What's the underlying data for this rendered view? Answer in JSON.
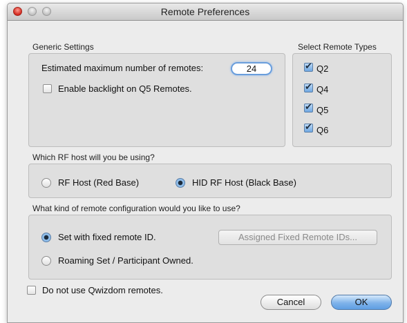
{
  "window": {
    "title": "Remote Preferences"
  },
  "generic": {
    "label": "Generic Settings",
    "max_remotes_label": "Estimated maximum number of remotes:",
    "max_remotes_value": "24",
    "backlight_label": "Enable backlight on Q5 Remotes.",
    "backlight_checked": false
  },
  "remote_types": {
    "label": "Select Remote Types",
    "items": [
      {
        "label": "Q2",
        "checked": true
      },
      {
        "label": "Q4",
        "checked": true
      },
      {
        "label": "Q5",
        "checked": true
      },
      {
        "label": "Q6",
        "checked": true
      }
    ]
  },
  "rf_host": {
    "label": "Which RF host will you be using?",
    "options": [
      {
        "label": "RF Host (Red Base)",
        "selected": false
      },
      {
        "label": "HID RF Host (Black Base)",
        "selected": true
      }
    ]
  },
  "config": {
    "label": "What kind of remote configuration would you like to use?",
    "options": [
      {
        "label": "Set with fixed remote ID.",
        "selected": true
      },
      {
        "label": "Roaming Set / Participant Owned.",
        "selected": false
      }
    ],
    "assigned_button": "Assigned Fixed Remote IDs..."
  },
  "footer": {
    "no_qwizdom_label": "Do not use Qwizdom remotes.",
    "no_qwizdom_checked": false,
    "cancel": "Cancel",
    "ok": "OK"
  }
}
